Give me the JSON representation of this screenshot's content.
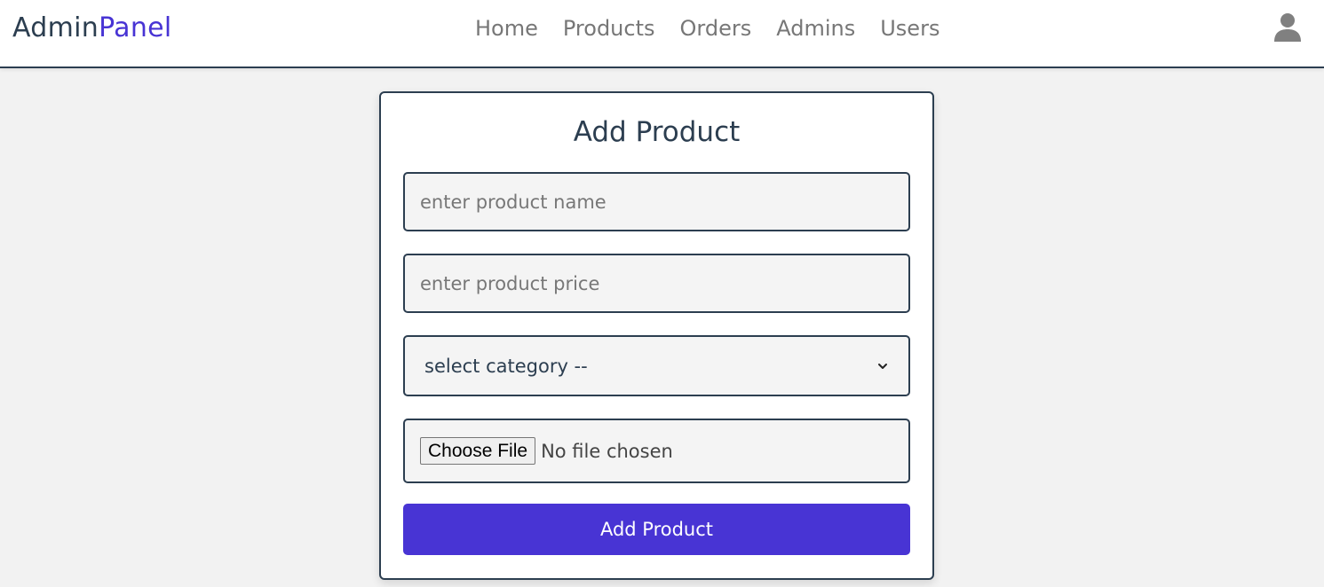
{
  "header": {
    "logo_main": "Admin",
    "logo_accent": "Panel",
    "nav": [
      {
        "label": "Home"
      },
      {
        "label": "Products"
      },
      {
        "label": "Orders"
      },
      {
        "label": "Admins"
      },
      {
        "label": "Users"
      }
    ],
    "user_icon": "user-icon"
  },
  "form": {
    "title": "Add Product",
    "name_placeholder": "enter product name",
    "price_placeholder": "enter product price",
    "category_selected": "select category --",
    "file_button_label": "Choose File",
    "file_status": "No file chosen",
    "submit_label": "Add Product"
  },
  "colors": {
    "accent": "#4834d4",
    "text_dark": "#2c3e50",
    "nav_text": "#777777",
    "page_bg": "#f2f2f2"
  }
}
